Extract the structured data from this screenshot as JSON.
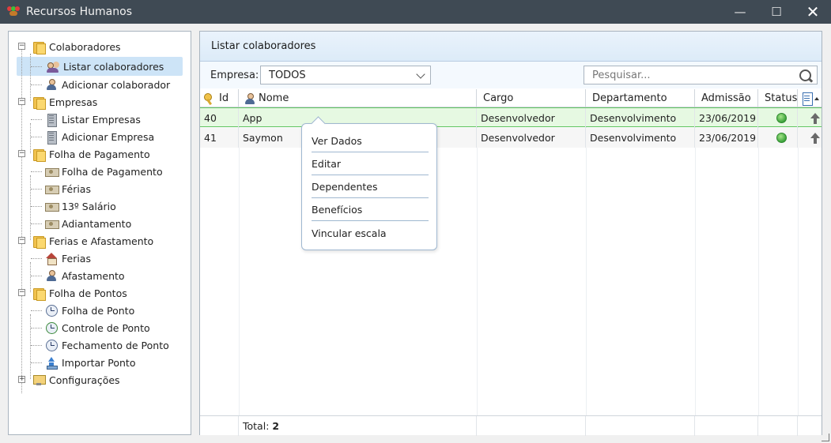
{
  "window": {
    "title": "Recursos Humanos",
    "controls": {
      "minimize": "—",
      "maximize": "☐",
      "close": "✕"
    }
  },
  "tree": {
    "groups": [
      {
        "label": "Colaboradores",
        "expanded": true,
        "icon": "folder-icon",
        "items": [
          {
            "label": "Listar colaboradores",
            "icon": "users-icon",
            "selected": true
          },
          {
            "label": "Adicionar colaborador",
            "icon": "user-add-icon"
          }
        ]
      },
      {
        "label": "Empresas",
        "expanded": true,
        "icon": "folder-icon",
        "items": [
          {
            "label": "Listar Empresas",
            "icon": "building-icon"
          },
          {
            "label": "Adicionar Empresa",
            "icon": "building-add-icon"
          }
        ]
      },
      {
        "label": "Folha de Pagamento",
        "expanded": true,
        "icon": "folder-icon",
        "items": [
          {
            "label": "Folha de Pagamento",
            "icon": "money-icon"
          },
          {
            "label": "Férias",
            "icon": "money-icon"
          },
          {
            "label": "13º Salário",
            "icon": "money-icon"
          },
          {
            "label": "Adiantamento",
            "icon": "money-icon"
          }
        ]
      },
      {
        "label": "Ferias e Afastamento",
        "expanded": true,
        "icon": "folder-icon",
        "items": [
          {
            "label": "Ferias",
            "icon": "house-icon"
          },
          {
            "label": "Afastamento",
            "icon": "user-icon"
          }
        ]
      },
      {
        "label": "Folha de Pontos",
        "expanded": true,
        "icon": "folder-icon",
        "items": [
          {
            "label": "Folha de Ponto",
            "icon": "clock-icon"
          },
          {
            "label": "Controle de Ponto",
            "icon": "clock-arrow-icon"
          },
          {
            "label": "Fechamento de Ponto",
            "icon": "clock-check-icon"
          },
          {
            "label": "Importar Ponto",
            "icon": "import-icon"
          }
        ]
      },
      {
        "label": "Configurações",
        "expanded": false,
        "icon": "config-icon",
        "items": []
      }
    ],
    "expander_open": "−",
    "expander_closed": "+"
  },
  "panel": {
    "title": "Listar colaboradores",
    "empresa_label": "Empresa:",
    "empresa_value": "TODOS",
    "search_placeholder": "Pesquisar..."
  },
  "grid": {
    "columns": [
      "Id",
      "Nome",
      "Cargo",
      "Departamento",
      "Admissão",
      "Status"
    ],
    "rows": [
      {
        "id": "40",
        "nome": "App",
        "cargo": "Desenvolvedor",
        "departamento": "Desenvolvimento",
        "admissao": "23/06/2019",
        "status": "active"
      },
      {
        "id": "41",
        "nome": "Saymon",
        "cargo": "Desenvolvedor",
        "departamento": "Desenvolvimento",
        "admissao": "23/06/2019",
        "status": "active"
      }
    ],
    "total_label": "Total:",
    "total_value": "2",
    "status_color": "#3ca33c",
    "selected_row_color": "#e6f9e2"
  },
  "context_menu": {
    "items": [
      "Ver Dados",
      "Editar",
      "Dependentes",
      "Benefícios",
      "Vincular escala"
    ]
  }
}
